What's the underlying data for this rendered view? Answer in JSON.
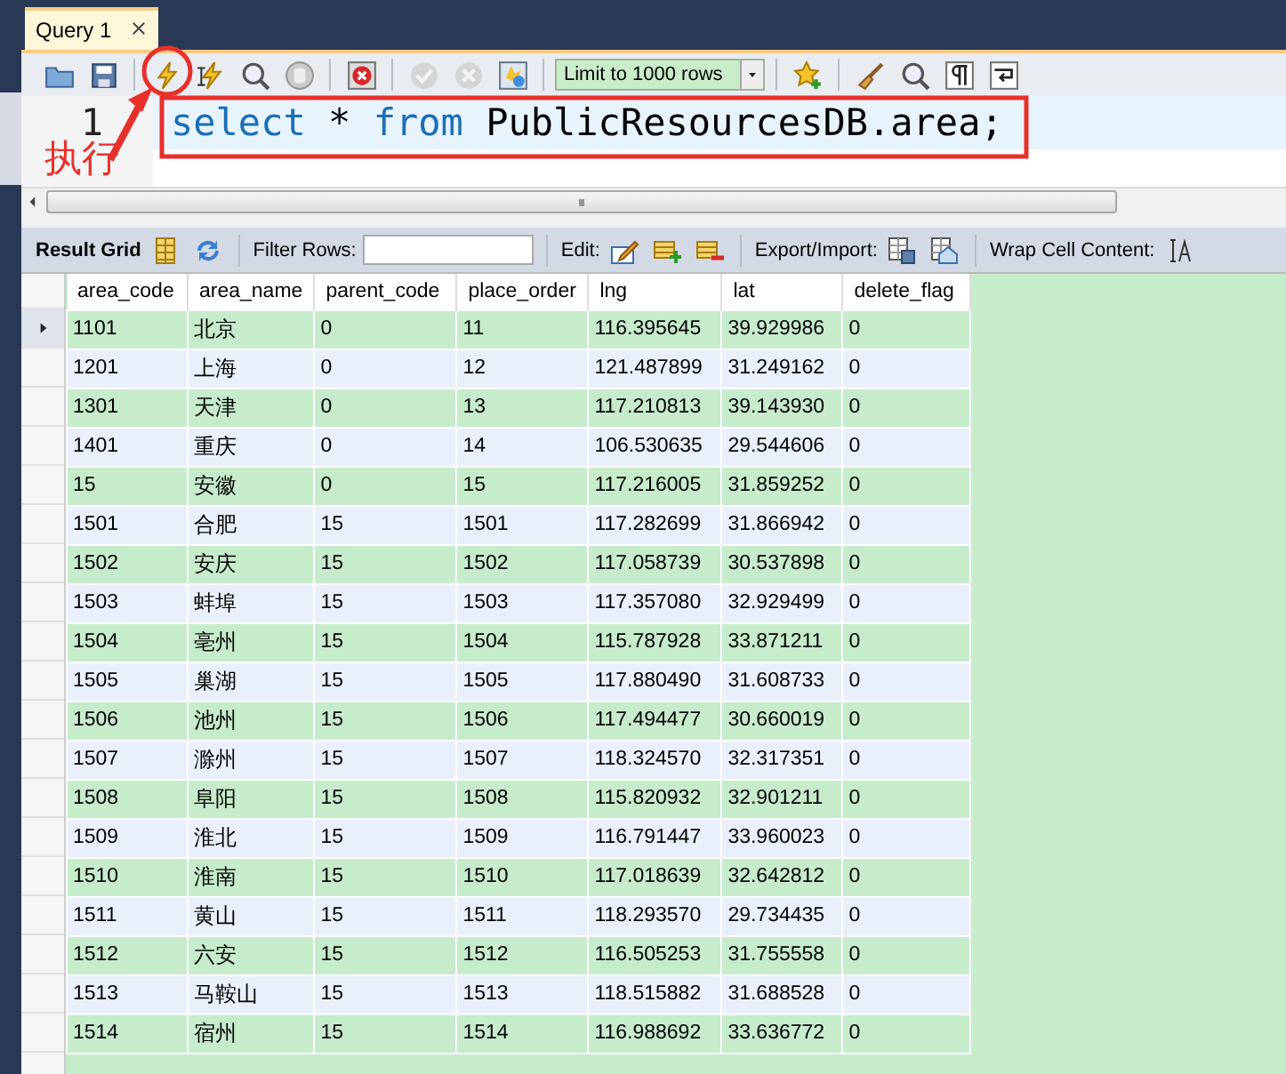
{
  "tab": {
    "label": "Query 1",
    "closable": true,
    "selected": true
  },
  "toolbar": {
    "buttons": [
      {
        "kind": "open",
        "disabled": false
      },
      {
        "kind": "save",
        "disabled": false
      },
      {
        "kind": "execute",
        "disabled": false
      },
      {
        "kind": "execute-current",
        "disabled": false
      },
      {
        "kind": "explain",
        "disabled": false
      },
      {
        "kind": "stop",
        "disabled": false
      },
      {
        "kind": "toggle-errors",
        "disabled": false
      },
      {
        "kind": "commit",
        "disabled": true
      },
      {
        "kind": "rollback",
        "disabled": true
      },
      {
        "kind": "autocommit",
        "disabled": false
      },
      {
        "kind": "limit",
        "label": "Limit to 1000 rows",
        "disabled": false
      },
      {
        "kind": "snippet",
        "disabled": false
      },
      {
        "kind": "beautify",
        "disabled": false
      },
      {
        "kind": "find",
        "disabled": false
      },
      {
        "kind": "invisibles",
        "disabled": false
      },
      {
        "kind": "wrap",
        "disabled": false
      }
    ]
  },
  "editor": {
    "line_number": "1",
    "tokens": [
      {
        "text": "select",
        "kind": "keyword"
      },
      {
        "text": "*",
        "kind": "plain"
      },
      {
        "text": "from",
        "kind": "keyword"
      },
      {
        "text": "PublicResourcesDB.area;",
        "kind": "plain"
      }
    ]
  },
  "annotation": {
    "label": "执行"
  },
  "result_toolbar": {
    "items": [
      {
        "kind": "label",
        "text": "Result Grid",
        "bold": true
      },
      {
        "kind": "icon"
      },
      {
        "kind": "icon"
      },
      {
        "kind": "label",
        "text": "Filter Rows:",
        "bold": false
      },
      {
        "kind": "field"
      },
      {
        "kind": "label",
        "text": "Edit:",
        "bold": false
      },
      {
        "kind": "icon"
      },
      {
        "kind": "icon"
      },
      {
        "kind": "icon"
      },
      {
        "kind": "label",
        "text": "Export/Import:",
        "bold": false
      },
      {
        "kind": "icon"
      },
      {
        "kind": "icon"
      },
      {
        "kind": "label",
        "text": "Wrap Cell Content:",
        "bold": false
      },
      {
        "kind": "icon"
      }
    ]
  },
  "table": {
    "columns": [
      "area_code",
      "area_name",
      "parent_code",
      "place_order",
      "lng",
      "lat",
      "delete_flag"
    ],
    "rows": [
      {
        "selected": true,
        "cells": [
          "1101",
          "北京",
          "0",
          "11",
          "116.395645",
          "39.929986",
          "0"
        ]
      },
      {
        "selected": false,
        "cells": [
          "1201",
          "上海",
          "0",
          "12",
          "121.487899",
          "31.249162",
          "0"
        ]
      },
      {
        "selected": false,
        "cells": [
          "1301",
          "天津",
          "0",
          "13",
          "117.210813",
          "39.143930",
          "0"
        ]
      },
      {
        "selected": false,
        "cells": [
          "1401",
          "重庆",
          "0",
          "14",
          "106.530635",
          "29.544606",
          "0"
        ]
      },
      {
        "selected": false,
        "cells": [
          "15",
          "安徽",
          "0",
          "15",
          "117.216005",
          "31.859252",
          "0"
        ]
      },
      {
        "selected": false,
        "cells": [
          "1501",
          "合肥",
          "15",
          "1501",
          "117.282699",
          "31.866942",
          "0"
        ]
      },
      {
        "selected": false,
        "cells": [
          "1502",
          "安庆",
          "15",
          "1502",
          "117.058739",
          "30.537898",
          "0"
        ]
      },
      {
        "selected": false,
        "cells": [
          "1503",
          "蚌埠",
          "15",
          "1503",
          "117.357080",
          "32.929499",
          "0"
        ]
      },
      {
        "selected": false,
        "cells": [
          "1504",
          "亳州",
          "15",
          "1504",
          "115.787928",
          "33.871211",
          "0"
        ]
      },
      {
        "selected": false,
        "cells": [
          "1505",
          "巢湖",
          "15",
          "1505",
          "117.880490",
          "31.608733",
          "0"
        ]
      },
      {
        "selected": false,
        "cells": [
          "1506",
          "池州",
          "15",
          "1506",
          "117.494477",
          "30.660019",
          "0"
        ]
      },
      {
        "selected": false,
        "cells": [
          "1507",
          "滁州",
          "15",
          "1507",
          "118.324570",
          "32.317351",
          "0"
        ]
      },
      {
        "selected": false,
        "cells": [
          "1508",
          "阜阳",
          "15",
          "1508",
          "115.820932",
          "32.901211",
          "0"
        ]
      },
      {
        "selected": false,
        "cells": [
          "1509",
          "淮北",
          "15",
          "1509",
          "116.791447",
          "33.960023",
          "0"
        ]
      },
      {
        "selected": false,
        "cells": [
          "1510",
          "淮南",
          "15",
          "1510",
          "117.018639",
          "32.642812",
          "0"
        ]
      },
      {
        "selected": false,
        "cells": [
          "1511",
          "黄山",
          "15",
          "1511",
          "118.293570",
          "29.734435",
          "0"
        ]
      },
      {
        "selected": false,
        "cells": [
          "1512",
          "六安",
          "15",
          "1512",
          "116.505253",
          "31.755558",
          "0"
        ]
      },
      {
        "selected": false,
        "cells": [
          "1513",
          "马鞍山",
          "15",
          "1513",
          "118.515882",
          "31.688528",
          "0"
        ]
      },
      {
        "selected": false,
        "cells": [
          "1514",
          "宿州",
          "15",
          "1514",
          "116.988692",
          "33.636772",
          "0"
        ]
      }
    ]
  }
}
